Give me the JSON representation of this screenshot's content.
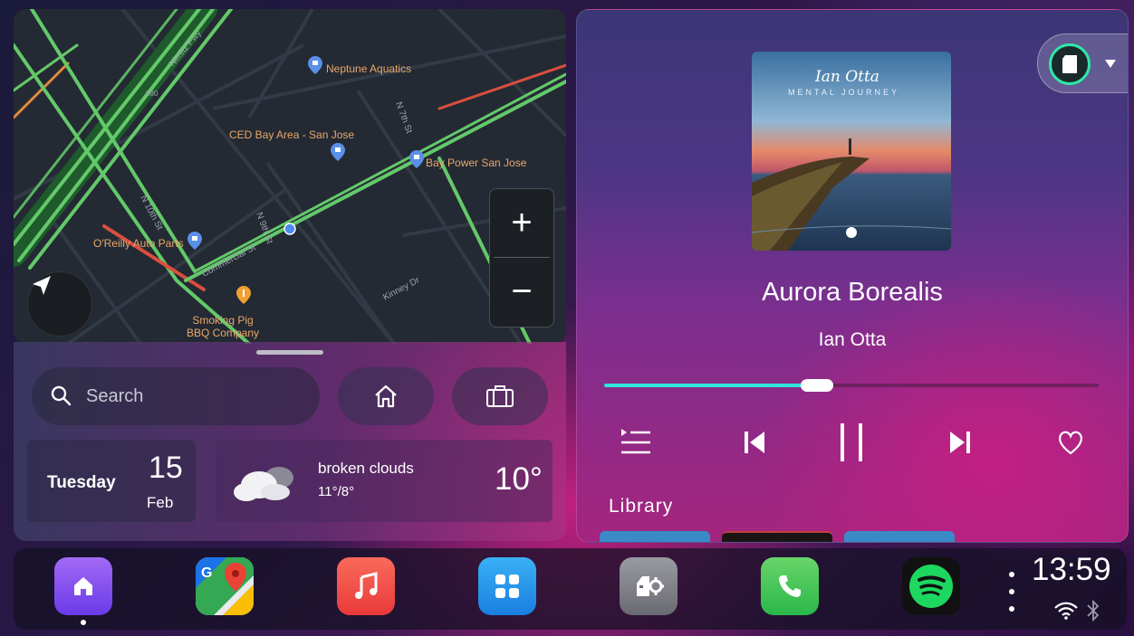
{
  "map": {
    "pois": [
      {
        "label": "Neptune Aquatics"
      },
      {
        "label": "CED Bay Area - San Jose"
      },
      {
        "label": "Bay Power San Jose"
      },
      {
        "label": "O'Reilly Auto Parts"
      },
      {
        "label": "Smoking Pig BBQ Company"
      }
    ],
    "streets": [
      "Nimitz Fwy",
      "N 7th St",
      "N 10th St",
      "Commercial St",
      "N 9th St",
      "Kinney Dr",
      "880"
    ],
    "zoom_in_label": "+",
    "zoom_out_label": "−"
  },
  "search": {
    "placeholder": "Search"
  },
  "date": {
    "weekday": "Tuesday",
    "day": "15",
    "month": "Feb"
  },
  "weather": {
    "condition": "broken clouds",
    "hi_lo": "11°/8°",
    "temp": "10°"
  },
  "now_playing": {
    "album_artist_script": "Ian Otta",
    "album_title": "MENTAL JOURNEY",
    "title": "Aurora Borealis",
    "artist": "Ian Otta",
    "progress": 0.43
  },
  "library": {
    "label": "Library"
  },
  "dock": {
    "apps": [
      "Home",
      "Google Maps",
      "Music",
      "Apps",
      "Car Settings",
      "Phone",
      "Spotify"
    ],
    "time": "13:59"
  }
}
